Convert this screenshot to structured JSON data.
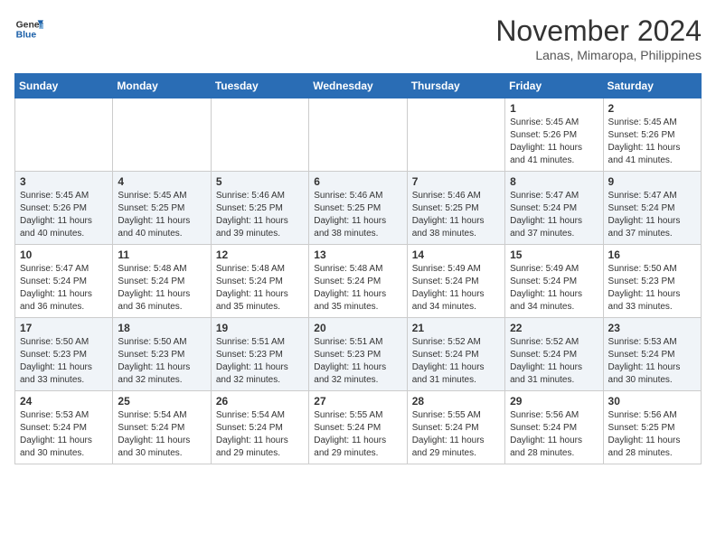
{
  "header": {
    "logo_line1": "General",
    "logo_line2": "Blue",
    "month_title": "November 2024",
    "location": "Lanas, Mimaropa, Philippines"
  },
  "weekdays": [
    "Sunday",
    "Monday",
    "Tuesday",
    "Wednesday",
    "Thursday",
    "Friday",
    "Saturday"
  ],
  "weeks": [
    [
      {
        "day": "",
        "sunrise": "",
        "sunset": "",
        "daylight": ""
      },
      {
        "day": "",
        "sunrise": "",
        "sunset": "",
        "daylight": ""
      },
      {
        "day": "",
        "sunrise": "",
        "sunset": "",
        "daylight": ""
      },
      {
        "day": "",
        "sunrise": "",
        "sunset": "",
        "daylight": ""
      },
      {
        "day": "",
        "sunrise": "",
        "sunset": "",
        "daylight": ""
      },
      {
        "day": "1",
        "sunrise": "Sunrise: 5:45 AM",
        "sunset": "Sunset: 5:26 PM",
        "daylight": "Daylight: 11 hours and 41 minutes."
      },
      {
        "day": "2",
        "sunrise": "Sunrise: 5:45 AM",
        "sunset": "Sunset: 5:26 PM",
        "daylight": "Daylight: 11 hours and 41 minutes."
      }
    ],
    [
      {
        "day": "3",
        "sunrise": "Sunrise: 5:45 AM",
        "sunset": "Sunset: 5:26 PM",
        "daylight": "Daylight: 11 hours and 40 minutes."
      },
      {
        "day": "4",
        "sunrise": "Sunrise: 5:45 AM",
        "sunset": "Sunset: 5:25 PM",
        "daylight": "Daylight: 11 hours and 40 minutes."
      },
      {
        "day": "5",
        "sunrise": "Sunrise: 5:46 AM",
        "sunset": "Sunset: 5:25 PM",
        "daylight": "Daylight: 11 hours and 39 minutes."
      },
      {
        "day": "6",
        "sunrise": "Sunrise: 5:46 AM",
        "sunset": "Sunset: 5:25 PM",
        "daylight": "Daylight: 11 hours and 38 minutes."
      },
      {
        "day": "7",
        "sunrise": "Sunrise: 5:46 AM",
        "sunset": "Sunset: 5:25 PM",
        "daylight": "Daylight: 11 hours and 38 minutes."
      },
      {
        "day": "8",
        "sunrise": "Sunrise: 5:47 AM",
        "sunset": "Sunset: 5:24 PM",
        "daylight": "Daylight: 11 hours and 37 minutes."
      },
      {
        "day": "9",
        "sunrise": "Sunrise: 5:47 AM",
        "sunset": "Sunset: 5:24 PM",
        "daylight": "Daylight: 11 hours and 37 minutes."
      }
    ],
    [
      {
        "day": "10",
        "sunrise": "Sunrise: 5:47 AM",
        "sunset": "Sunset: 5:24 PM",
        "daylight": "Daylight: 11 hours and 36 minutes."
      },
      {
        "day": "11",
        "sunrise": "Sunrise: 5:48 AM",
        "sunset": "Sunset: 5:24 PM",
        "daylight": "Daylight: 11 hours and 36 minutes."
      },
      {
        "day": "12",
        "sunrise": "Sunrise: 5:48 AM",
        "sunset": "Sunset: 5:24 PM",
        "daylight": "Daylight: 11 hours and 35 minutes."
      },
      {
        "day": "13",
        "sunrise": "Sunrise: 5:48 AM",
        "sunset": "Sunset: 5:24 PM",
        "daylight": "Daylight: 11 hours and 35 minutes."
      },
      {
        "day": "14",
        "sunrise": "Sunrise: 5:49 AM",
        "sunset": "Sunset: 5:24 PM",
        "daylight": "Daylight: 11 hours and 34 minutes."
      },
      {
        "day": "15",
        "sunrise": "Sunrise: 5:49 AM",
        "sunset": "Sunset: 5:24 PM",
        "daylight": "Daylight: 11 hours and 34 minutes."
      },
      {
        "day": "16",
        "sunrise": "Sunrise: 5:50 AM",
        "sunset": "Sunset: 5:23 PM",
        "daylight": "Daylight: 11 hours and 33 minutes."
      }
    ],
    [
      {
        "day": "17",
        "sunrise": "Sunrise: 5:50 AM",
        "sunset": "Sunset: 5:23 PM",
        "daylight": "Daylight: 11 hours and 33 minutes."
      },
      {
        "day": "18",
        "sunrise": "Sunrise: 5:50 AM",
        "sunset": "Sunset: 5:23 PM",
        "daylight": "Daylight: 11 hours and 32 minutes."
      },
      {
        "day": "19",
        "sunrise": "Sunrise: 5:51 AM",
        "sunset": "Sunset: 5:23 PM",
        "daylight": "Daylight: 11 hours and 32 minutes."
      },
      {
        "day": "20",
        "sunrise": "Sunrise: 5:51 AM",
        "sunset": "Sunset: 5:23 PM",
        "daylight": "Daylight: 11 hours and 32 minutes."
      },
      {
        "day": "21",
        "sunrise": "Sunrise: 5:52 AM",
        "sunset": "Sunset: 5:24 PM",
        "daylight": "Daylight: 11 hours and 31 minutes."
      },
      {
        "day": "22",
        "sunrise": "Sunrise: 5:52 AM",
        "sunset": "Sunset: 5:24 PM",
        "daylight": "Daylight: 11 hours and 31 minutes."
      },
      {
        "day": "23",
        "sunrise": "Sunrise: 5:53 AM",
        "sunset": "Sunset: 5:24 PM",
        "daylight": "Daylight: 11 hours and 30 minutes."
      }
    ],
    [
      {
        "day": "24",
        "sunrise": "Sunrise: 5:53 AM",
        "sunset": "Sunset: 5:24 PM",
        "daylight": "Daylight: 11 hours and 30 minutes."
      },
      {
        "day": "25",
        "sunrise": "Sunrise: 5:54 AM",
        "sunset": "Sunset: 5:24 PM",
        "daylight": "Daylight: 11 hours and 30 minutes."
      },
      {
        "day": "26",
        "sunrise": "Sunrise: 5:54 AM",
        "sunset": "Sunset: 5:24 PM",
        "daylight": "Daylight: 11 hours and 29 minutes."
      },
      {
        "day": "27",
        "sunrise": "Sunrise: 5:55 AM",
        "sunset": "Sunset: 5:24 PM",
        "daylight": "Daylight: 11 hours and 29 minutes."
      },
      {
        "day": "28",
        "sunrise": "Sunrise: 5:55 AM",
        "sunset": "Sunset: 5:24 PM",
        "daylight": "Daylight: 11 hours and 29 minutes."
      },
      {
        "day": "29",
        "sunrise": "Sunrise: 5:56 AM",
        "sunset": "Sunset: 5:24 PM",
        "daylight": "Daylight: 11 hours and 28 minutes."
      },
      {
        "day": "30",
        "sunrise": "Sunrise: 5:56 AM",
        "sunset": "Sunset: 5:25 PM",
        "daylight": "Daylight: 11 hours and 28 minutes."
      }
    ]
  ]
}
